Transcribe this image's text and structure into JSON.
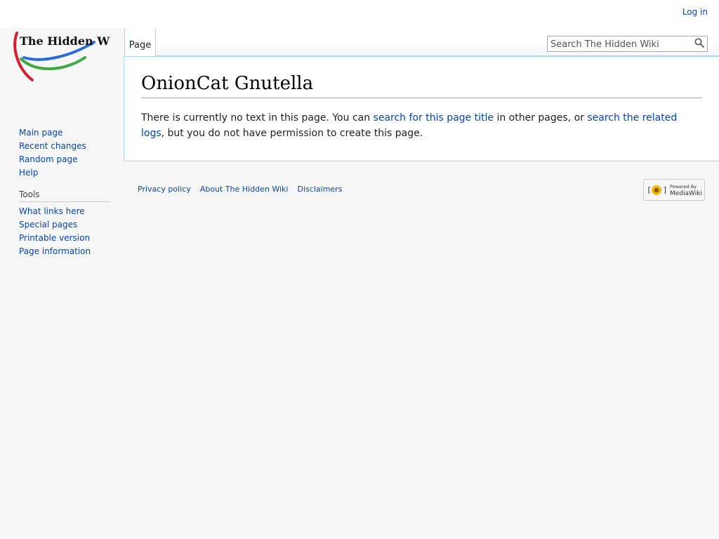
{
  "personal": {
    "login": "Log in"
  },
  "logo": {
    "text": "The Hidden Wiki"
  },
  "tabs": {
    "page": "Page"
  },
  "search": {
    "placeholder": "Search The Hidden Wiki"
  },
  "sidebar": {
    "nav": [
      "Main page",
      "Recent changes",
      "Random page",
      "Help"
    ],
    "tools_heading": "Tools",
    "tools": [
      "What links here",
      "Special pages",
      "Printable version",
      "Page information"
    ]
  },
  "content": {
    "title": "OnionCat Gnutella",
    "text_1": "There is currently no text in this page. You can ",
    "link_1": "search for this page title",
    "text_2": " in other pages, or ",
    "link_2": "search the related logs",
    "text_3": ", but you do not have permission to create this page."
  },
  "footer": {
    "links": [
      "Privacy policy",
      "About The Hidden Wiki",
      "Disclaimers"
    ],
    "powered_line1": "Powered By",
    "powered_line2": "MediaWiki"
  },
  "colors": {
    "link": "#0645ad",
    "border": "#a7d7f9"
  }
}
